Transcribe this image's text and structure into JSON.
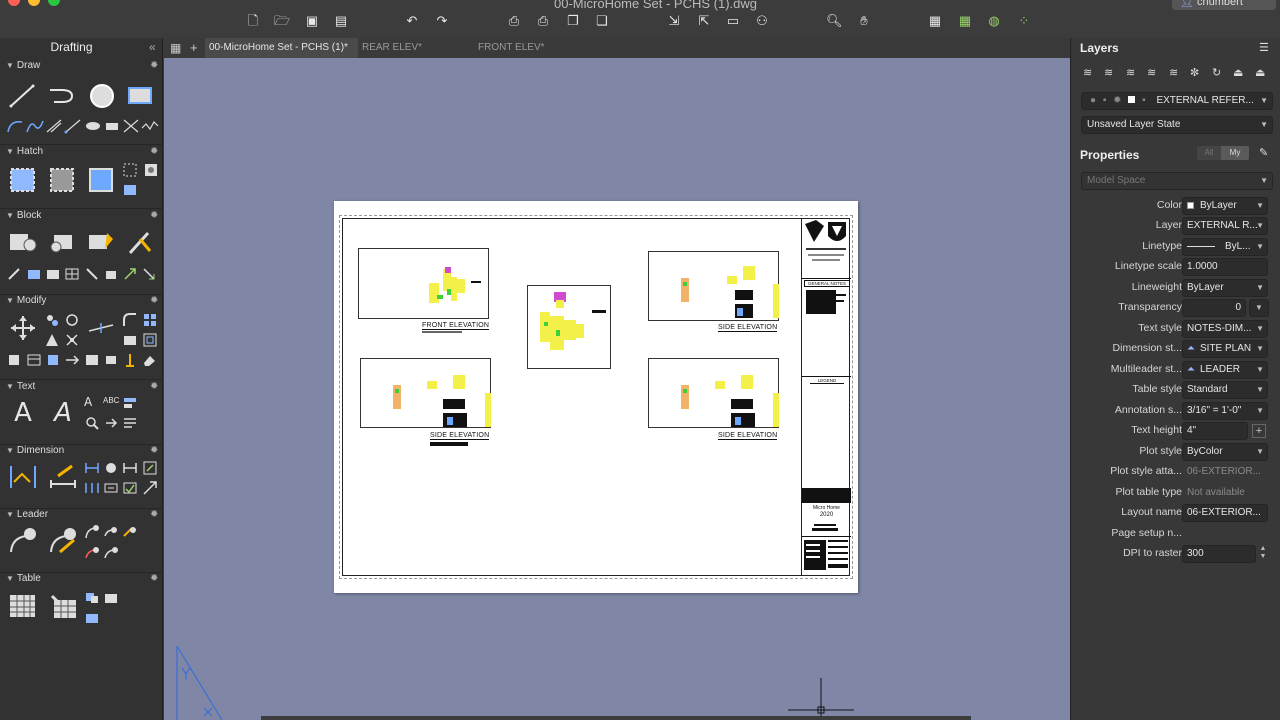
{
  "window": {
    "title": "00-MicroHome Set - PCHS (1).dwg",
    "user": "cnumbert"
  },
  "colors": {
    "canvas_bg": "#7f86a6",
    "panel_bg": "#323232",
    "toolbar_bg": "#3c3c3c",
    "traffic_red": "#fd5f57",
    "traffic_yellow": "#febc2e",
    "traffic_green": "#28c840"
  },
  "tool_palette": {
    "title": "Drafting",
    "sections": [
      "Draw",
      "Hatch",
      "Block",
      "Modify",
      "Text",
      "Dimension",
      "Leader",
      "Table"
    ]
  },
  "tabs": [
    {
      "label": "00-MicroHome Set - PCHS (1)*",
      "active": true
    },
    {
      "label": "REAR ELEV*",
      "active": false
    },
    {
      "label": "FRONT ELEV*",
      "active": false
    }
  ],
  "drawing": {
    "view_labels": [
      "FRONT ELEVATION",
      "SIDE ELEVATION",
      "SIDE ELEVATION",
      "SIDE ELEVATION"
    ],
    "title_block_notes_1": "GENERAL NOTES",
    "title_block_notes_2": "LEGEND",
    "project_name": "Micro Home",
    "project_year": "2020"
  },
  "layers": {
    "title": "Layers",
    "current_layer": "EXTERNAL REFER...",
    "layer_state": "Unsaved Layer State"
  },
  "properties": {
    "title": "Properties",
    "filter_all": "All",
    "filter_my": "My",
    "space": "Model Space",
    "rows": [
      {
        "label": "Color",
        "value": "ByLayer"
      },
      {
        "label": "Layer",
        "value": "EXTERNAL R..."
      },
      {
        "label": "Linetype",
        "value": "ByL..."
      },
      {
        "label": "Linetype scale",
        "value": "1.0000"
      },
      {
        "label": "Lineweight",
        "value": "ByLayer"
      },
      {
        "label": "Transparency",
        "value": "0"
      },
      {
        "label": "Text style",
        "value": "NOTES-DIM..."
      },
      {
        "label": "Dimension st...",
        "value": "SITE PLAN"
      },
      {
        "label": "Multileader st...",
        "value": "LEADER"
      },
      {
        "label": "Table style",
        "value": "Standard"
      },
      {
        "label": "Annotation s...",
        "value": "3/16\" = 1'-0\""
      },
      {
        "label": "Text height",
        "value": "4\""
      },
      {
        "label": "Plot style",
        "value": "ByColor"
      },
      {
        "label": "Plot style atta...",
        "value": "06-EXTERIOR..."
      },
      {
        "label": "Plot table type",
        "value": "Not available"
      },
      {
        "label": "Layout name",
        "value": "06-EXTERIOR..."
      },
      {
        "label": "Page setup n...",
        "value": ""
      },
      {
        "label": "DPI to raster",
        "value": "300"
      }
    ]
  }
}
